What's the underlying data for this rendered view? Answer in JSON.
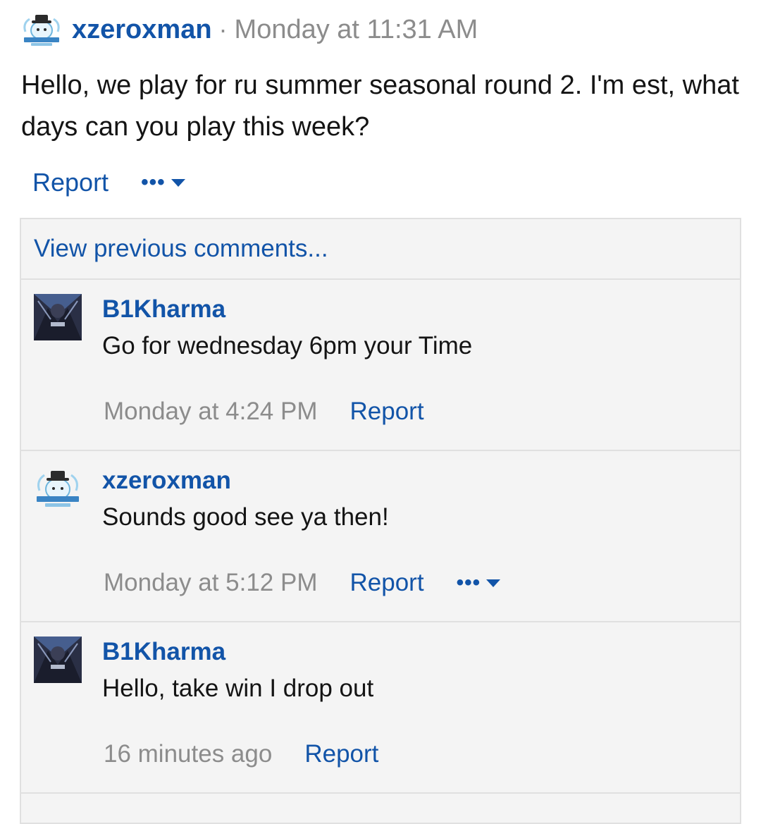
{
  "post": {
    "author": "xzeroxman",
    "separator": "·",
    "time": "Monday at 11:31 AM",
    "body": "Hello, we play for ru summer seasonal round 2. I'm est, what days can you play this week?",
    "report_label": "Report",
    "more_label": "•••"
  },
  "comments": {
    "view_previous": "View previous comments...",
    "items": [
      {
        "author": "B1Kharma",
        "text": "Go for wednesday 6pm your Time",
        "time": "Monday at 4:24 PM",
        "report_label": "Report",
        "avatar_icon": "dark-character-avatar"
      },
      {
        "author": "xzeroxman",
        "text": "Sounds good see ya then!",
        "time": "Monday at 5:12 PM",
        "report_label": "Report",
        "more_label": "•••",
        "avatar_icon": "snowman-mascot-avatar"
      },
      {
        "author": "B1Kharma",
        "text": "Hello, take win I drop out",
        "time": "16 minutes ago",
        "report_label": "Report",
        "avatar_icon": "dark-character-avatar"
      }
    ]
  },
  "colors": {
    "link": "#1254a8",
    "muted": "#8c8c8c",
    "panel": "#f4f4f4",
    "border": "#e0e0e0"
  }
}
